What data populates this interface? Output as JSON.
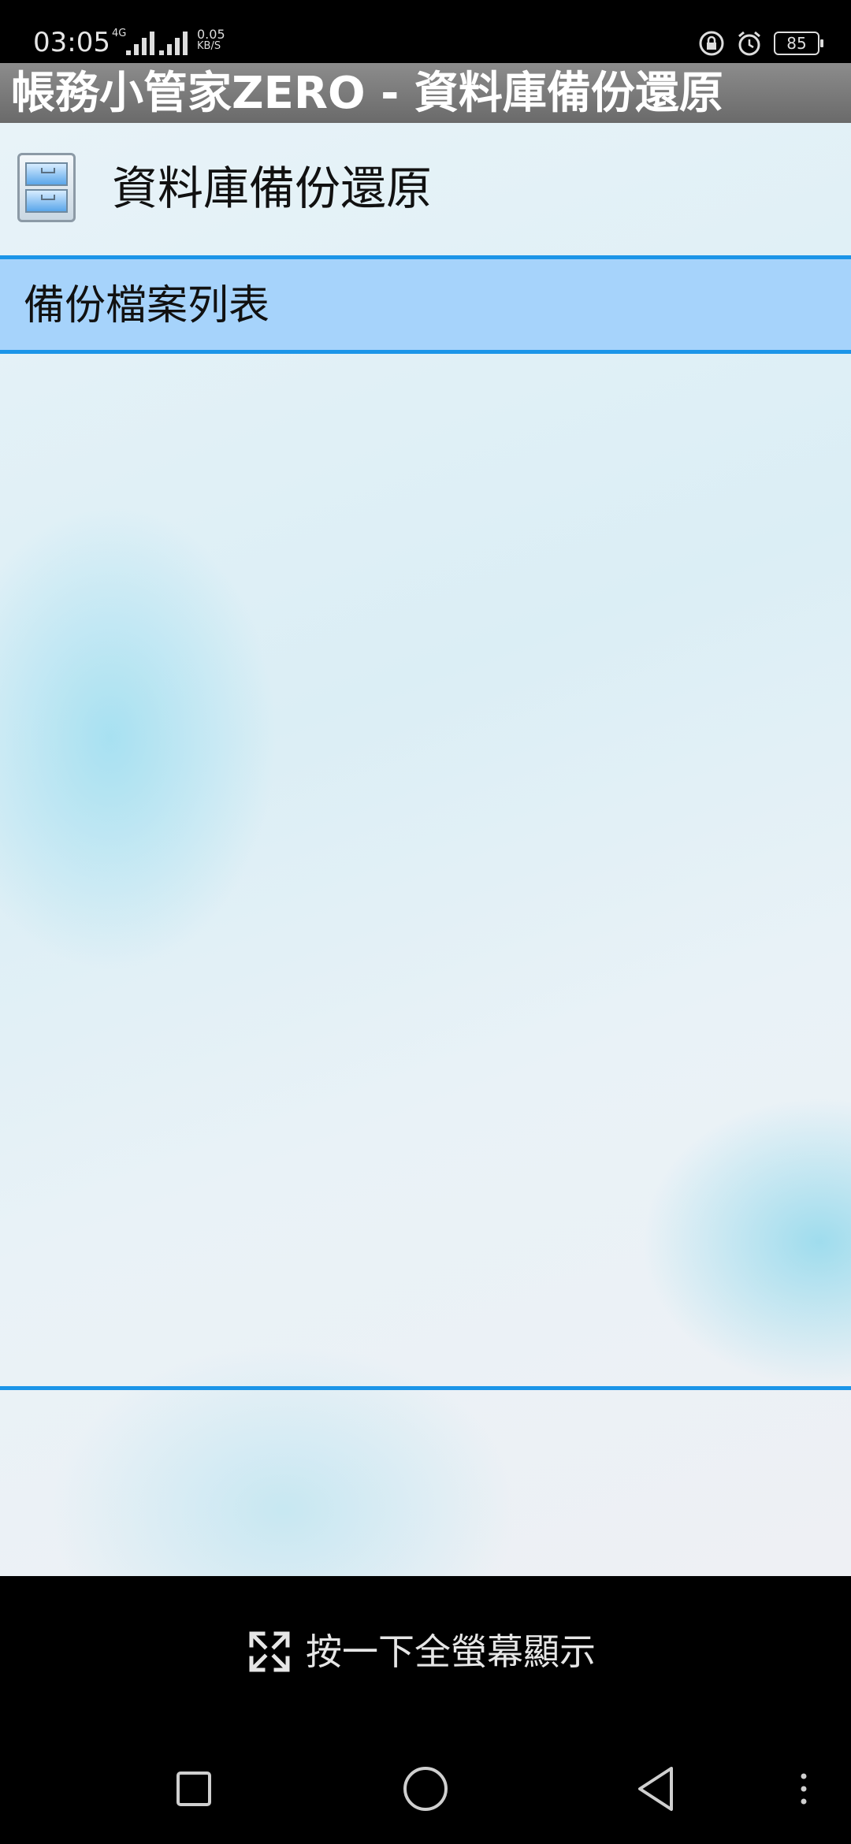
{
  "status_bar": {
    "time": "03:05",
    "network": "4G",
    "speed_value": "0.05",
    "speed_unit": "KB/S",
    "battery": "85"
  },
  "app": {
    "window_title": "帳務小管家ZERO - 資料庫備份還原"
  },
  "page": {
    "title": "資料庫備份還原",
    "icon": "file-cabinet-icon"
  },
  "section": {
    "label": "備份檔案列表"
  },
  "backup_files": [],
  "fullscreen": {
    "label": "按一下全螢幕顯示",
    "icon": "expand-icon"
  },
  "colors": {
    "accent_line": "#1b95e8",
    "section_bg": "#a6d3fb",
    "title_bar": "#7a7a7a"
  }
}
